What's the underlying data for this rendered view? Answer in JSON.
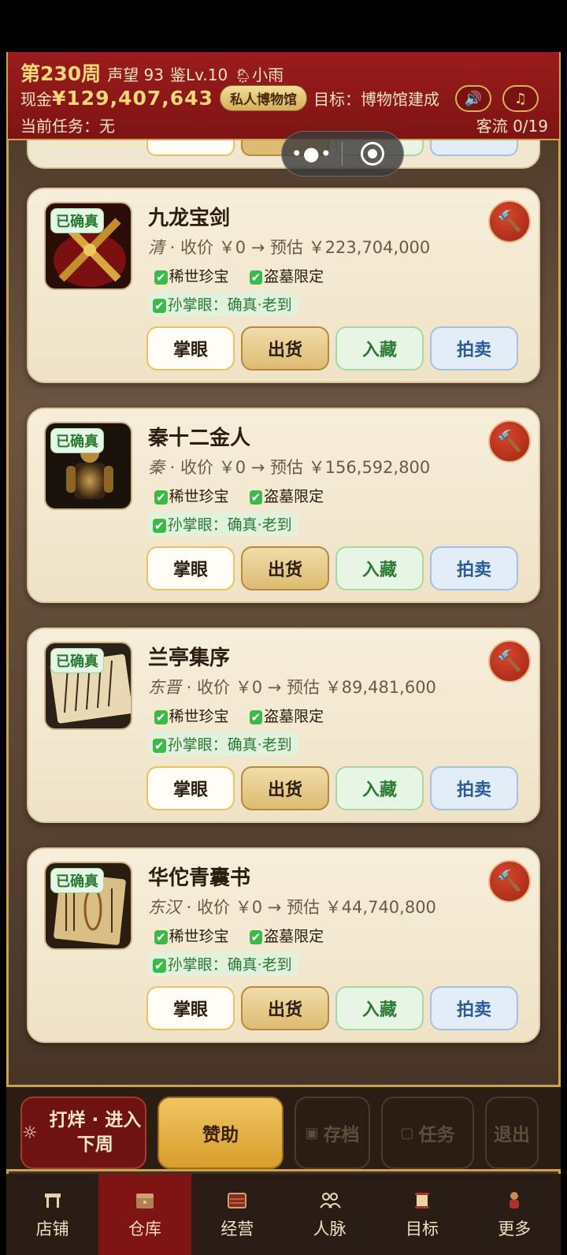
{
  "header": {
    "week": "第230周",
    "reputation": "声望 93",
    "appraisal_level": "鉴Lv.10",
    "weather": "小雨",
    "cash_label": "现金",
    "cash_value": "¥129,407,643",
    "museum_badge": "私人博物馆",
    "goal": "目标：博物馆建成",
    "task": "当前任务：无",
    "traffic": "客流 0/19",
    "sound_icon": "speaker-icon",
    "music_icon": "music-note-icon"
  },
  "items": [
    {
      "tag": "已确真",
      "name": "九龙宝剑",
      "era": "清",
      "price_text": " · 收价 ￥0 → 预估 ￥223,704,000",
      "tag1": "稀世珍宝",
      "tag2": "盗墓限定",
      "expert": "孙掌眼：确真·老到"
    },
    {
      "tag": "已确真",
      "name": "秦十二金人",
      "era": "秦",
      "price_text": " · 收价 ￥0 → 预估 ￥156,592,800",
      "tag1": "稀世珍宝",
      "tag2": "盗墓限定",
      "expert": "孙掌眼：确真·老到"
    },
    {
      "tag": "已确真",
      "name": "兰亭集序",
      "era": "东晋",
      "price_text": " · 收价 ￥0 → 预估 ￥89,481,600",
      "tag1": "稀世珍宝",
      "tag2": "盗墓限定",
      "expert": "孙掌眼：确真·老到"
    },
    {
      "tag": "已确真",
      "name": "华佗青囊书",
      "era": "东汉",
      "price_text": " · 收价 ￥0 → 预估 ￥44,740,800",
      "tag1": "稀世珍宝",
      "tag2": "盗墓限定",
      "expert": "孙掌眼：确真·老到"
    }
  ],
  "card_buttons": {
    "inspect": "掌眼",
    "ship": "出货",
    "collect": "入藏",
    "auction": "拍卖"
  },
  "actions": {
    "forge": "打烊 · 进入下周",
    "sponsor": "赞助",
    "save": "存档",
    "task": "任务",
    "exit": "退出"
  },
  "tabs": [
    {
      "label": "店铺",
      "icon": "shop-icon"
    },
    {
      "label": "仓库",
      "icon": "warehouse-icon"
    },
    {
      "label": "经营",
      "icon": "abacus-icon"
    },
    {
      "label": "人脉",
      "icon": "people-icon"
    },
    {
      "label": "目标",
      "icon": "scroll-icon"
    },
    {
      "label": "更多",
      "icon": "more-icon"
    }
  ],
  "active_tab": "仓库",
  "colors": {
    "header_red": "#9b1c1c",
    "gold": "#c9a44a",
    "card_bg": "#f7eedb",
    "confirmed_green": "#247a30"
  }
}
